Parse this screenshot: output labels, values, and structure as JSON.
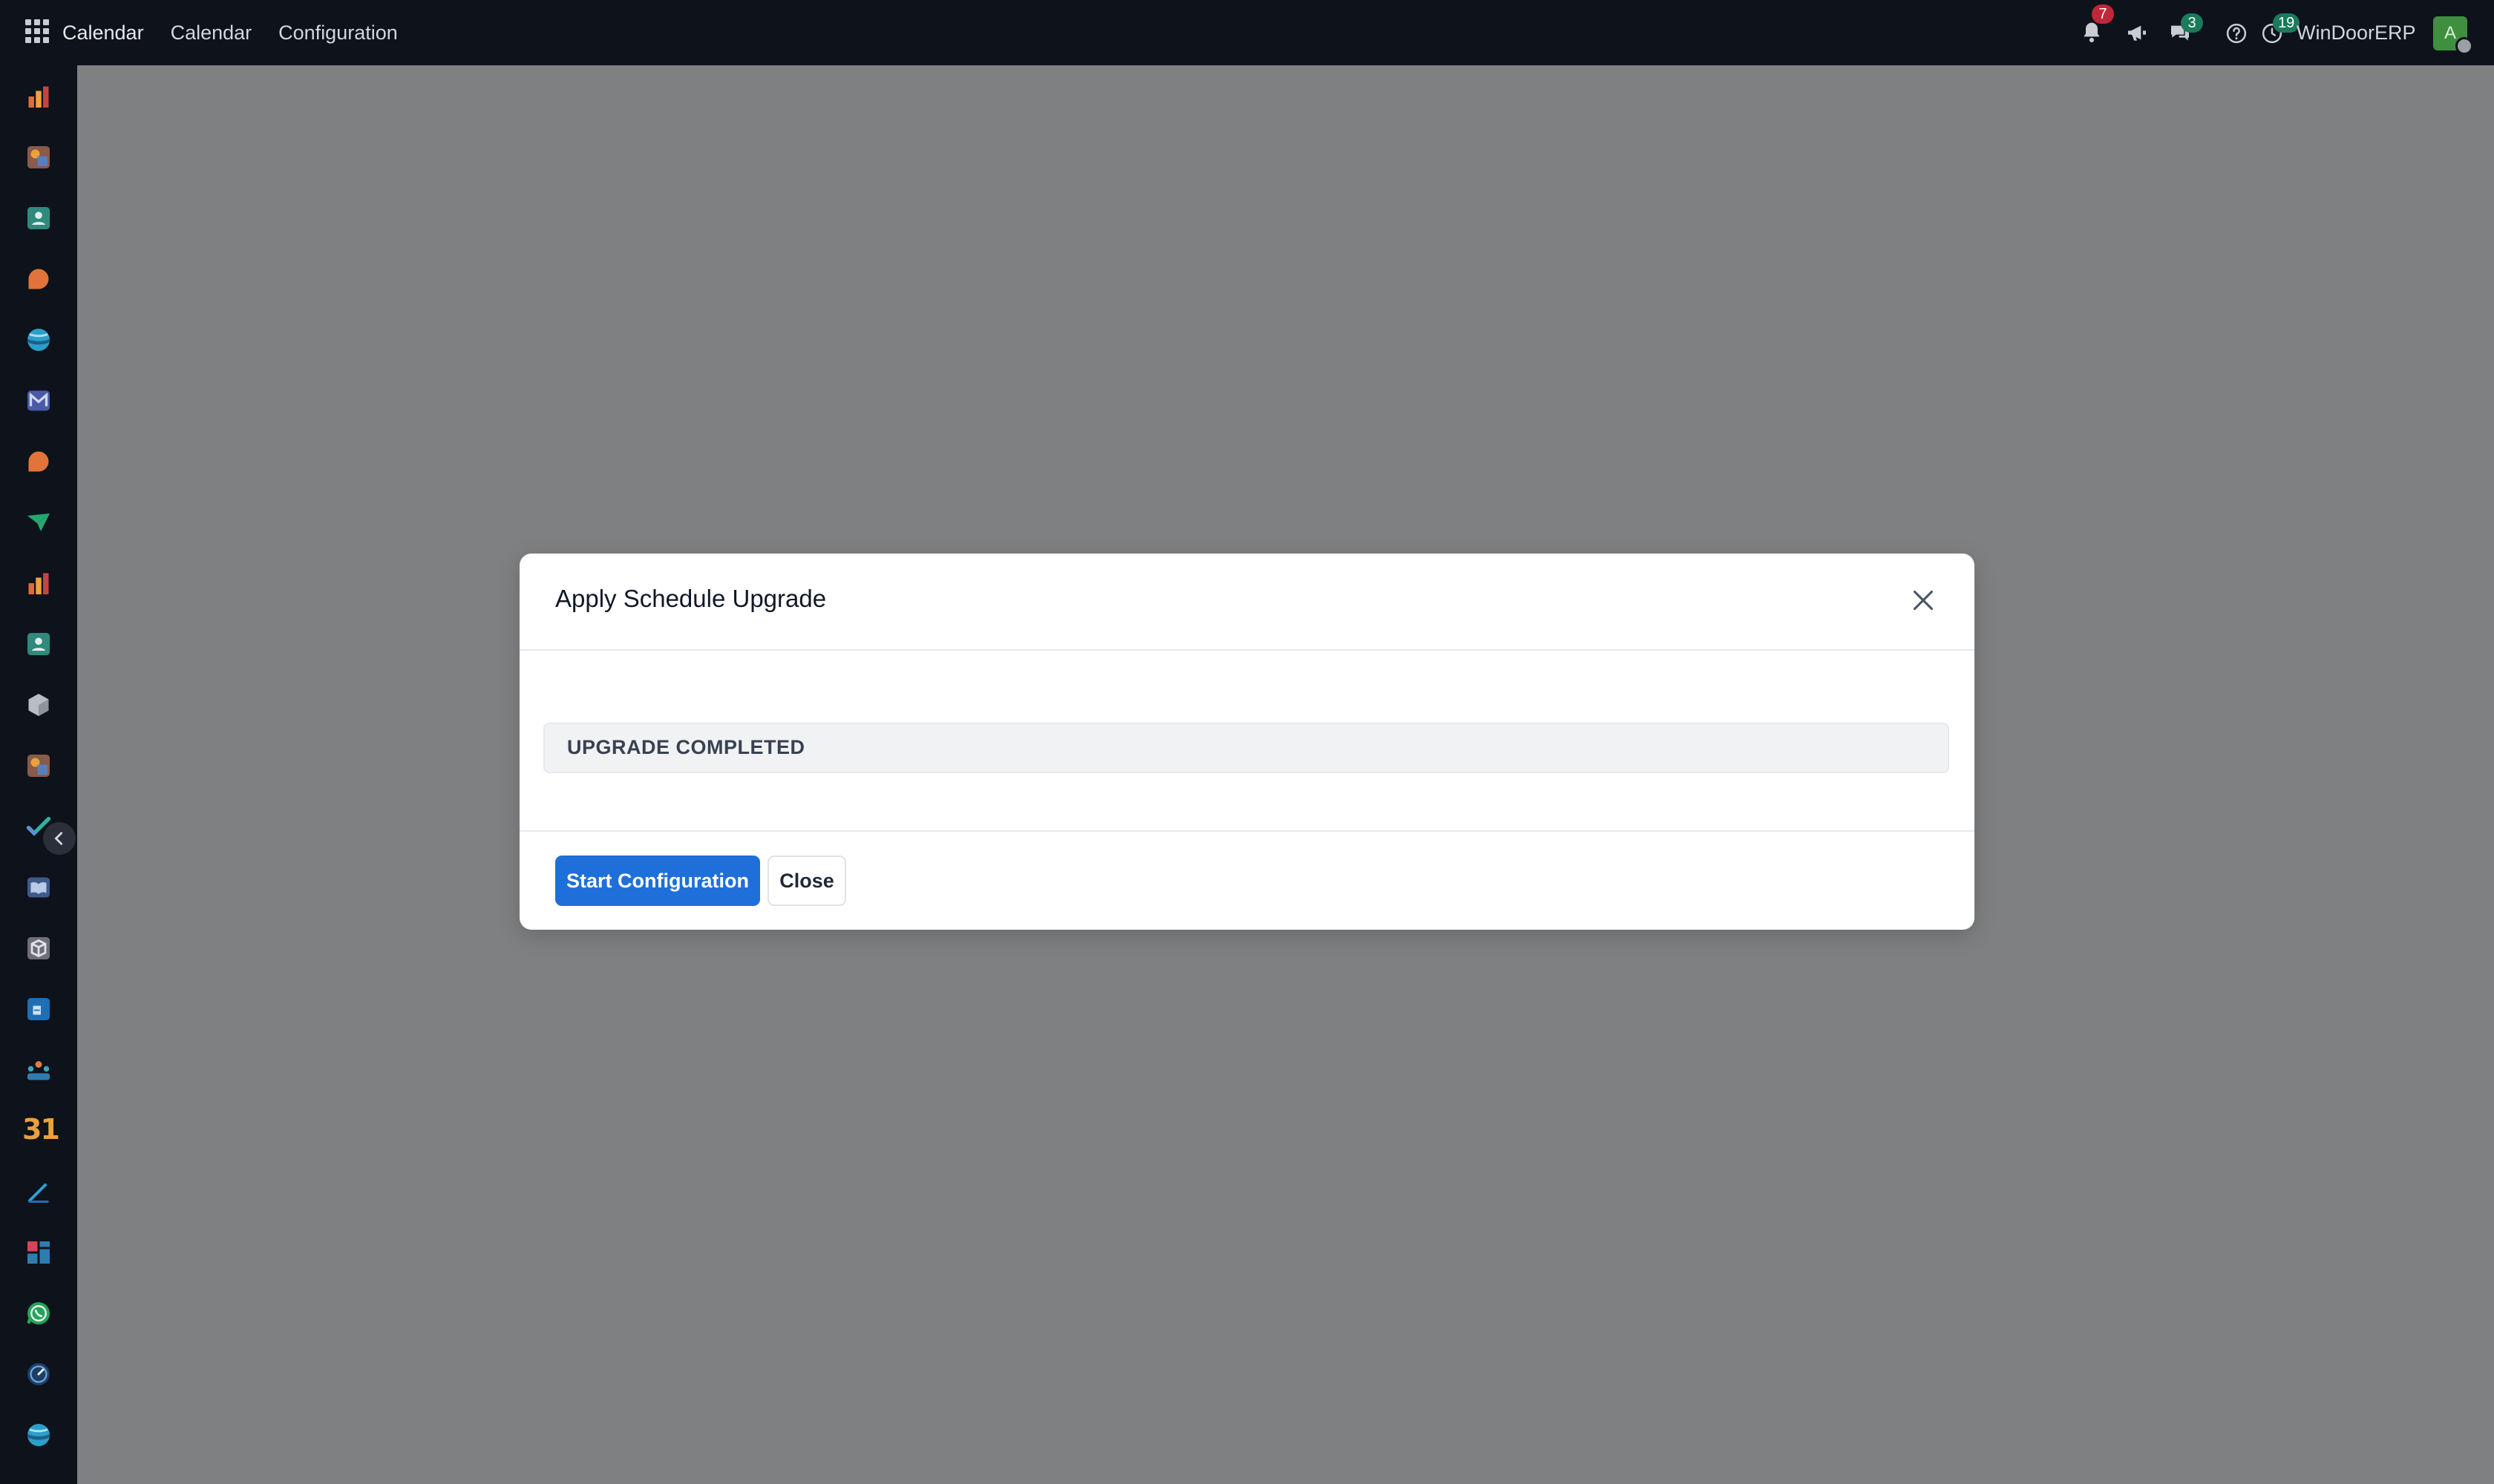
{
  "topbar": {
    "brand": "Calendar",
    "menu": [
      "Calendar",
      "Configuration"
    ],
    "systray": {
      "notifications_count": "7",
      "messages_count": "3",
      "activities_count": "19",
      "company": "WinDoorERP",
      "avatar_initial": "A"
    }
  },
  "sidebar": {
    "icons": [
      "chart-bars-icon",
      "colorful-square-icon",
      "contact-card-icon",
      "chat-bubble-icon",
      "sphere-icon",
      "mail-icon",
      "chat-bubble-icon",
      "paper-plane-icon",
      "chart-bars-icon",
      "contact-card-icon",
      "hexagon-box-icon",
      "colorful-square-icon",
      "checkmark-icon",
      "book-icon",
      "package-icon",
      "document-icon",
      "team-icon",
      "calendar-31-icon",
      "pen-icon",
      "dashboard-icon",
      "whatsapp-icon",
      "gauge-icon",
      "sphere-icon"
    ],
    "calendar_icon_text": "31"
  },
  "modal": {
    "title": "Apply Schedule Upgrade",
    "status": "UPGRADE COMPLETED",
    "primary_button": "Start Configuration",
    "secondary_button": "Close"
  },
  "colors": {
    "navbar": "#0e121b",
    "backdrop": "#7f8082",
    "primary": "#1e6fd9",
    "badge_red": "#c0283a",
    "badge_green": "#1b7a5a"
  }
}
